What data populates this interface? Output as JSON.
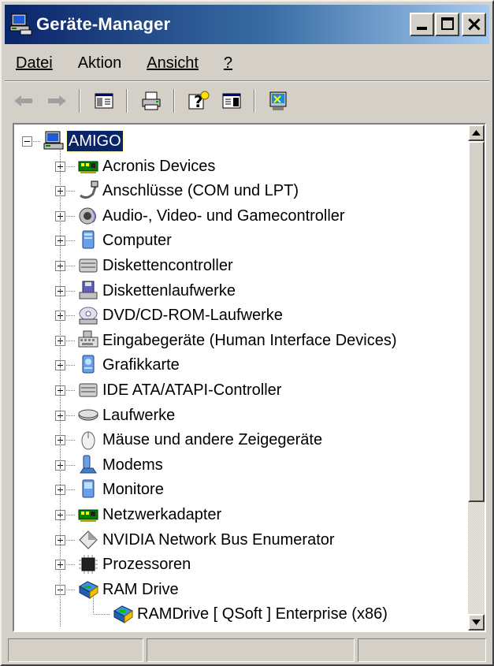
{
  "window": {
    "title": "Geräte-Manager",
    "title_icon": "device-manager-icon",
    "buttons": [
      "minimize-icon",
      "maximize-icon",
      "close-icon"
    ]
  },
  "menu": {
    "items": [
      {
        "label": "Datei"
      },
      {
        "label": "Aktion"
      },
      {
        "label": "Ansicht"
      },
      {
        "label": "?"
      }
    ]
  },
  "toolbar": {
    "items": [
      "back-arrow-icon",
      "forward-arrow-icon",
      "show-hide-console-tree-icon",
      "print-icon",
      "help-icon",
      "properties-icon",
      "scan-hardware-icon"
    ]
  },
  "tree": {
    "root": {
      "label": "AMIGO",
      "icon": "computer-icon",
      "expanded": true,
      "selected": true
    },
    "categories": [
      {
        "label": "Acronis Devices",
        "icon": "network-card-icon",
        "expanded": false
      },
      {
        "label": "Anschlüsse (COM und LPT)",
        "icon": "port-icon",
        "expanded": false
      },
      {
        "label": "Audio-, Video- und Gamecontroller",
        "icon": "speaker-icon",
        "expanded": false
      },
      {
        "label": "Computer",
        "icon": "computer-monitor-icon",
        "expanded": false
      },
      {
        "label": "Diskettencontroller",
        "icon": "controller-icon",
        "expanded": false
      },
      {
        "label": "Diskettenlaufwerke",
        "icon": "floppy-drive-icon",
        "expanded": false
      },
      {
        "label": "DVD/CD-ROM-Laufwerke",
        "icon": "cd-drive-icon",
        "expanded": false
      },
      {
        "label": "Eingabegeräte (Human Interface Devices)",
        "icon": "keyboard-icon",
        "expanded": false
      },
      {
        "label": "Grafikkarte",
        "icon": "display-adapter-icon",
        "expanded": false
      },
      {
        "label": "IDE ATA/ATAPI-Controller",
        "icon": "controller-icon",
        "expanded": false
      },
      {
        "label": "Laufwerke",
        "icon": "hard-drive-icon",
        "expanded": false
      },
      {
        "label": "Mäuse und andere Zeigegeräte",
        "icon": "mouse-icon",
        "expanded": false
      },
      {
        "label": "Modems",
        "icon": "modem-icon",
        "expanded": false
      },
      {
        "label": "Monitore",
        "icon": "monitor-icon",
        "expanded": false
      },
      {
        "label": "Netzwerkadapter",
        "icon": "network-card-icon",
        "expanded": false
      },
      {
        "label": "NVIDIA Network Bus Enumerator",
        "icon": "diamond-icon",
        "expanded": false
      },
      {
        "label": "Prozessoren",
        "icon": "processor-icon",
        "expanded": false
      },
      {
        "label": "RAM Drive",
        "icon": "ram-drive-icon",
        "expanded": true,
        "children": [
          {
            "label": "RAMDrive [ QSoft ] Enterprise (x86)",
            "icon": "ram-drive-icon"
          }
        ]
      }
    ]
  },
  "colors": {
    "title_gradient_start": "#0a246a",
    "title_gradient_end": "#a6caf0",
    "selection": "#0a246a",
    "face": "#d4d0c8"
  },
  "statusbar": {
    "panes": [
      "",
      "",
      ""
    ]
  }
}
